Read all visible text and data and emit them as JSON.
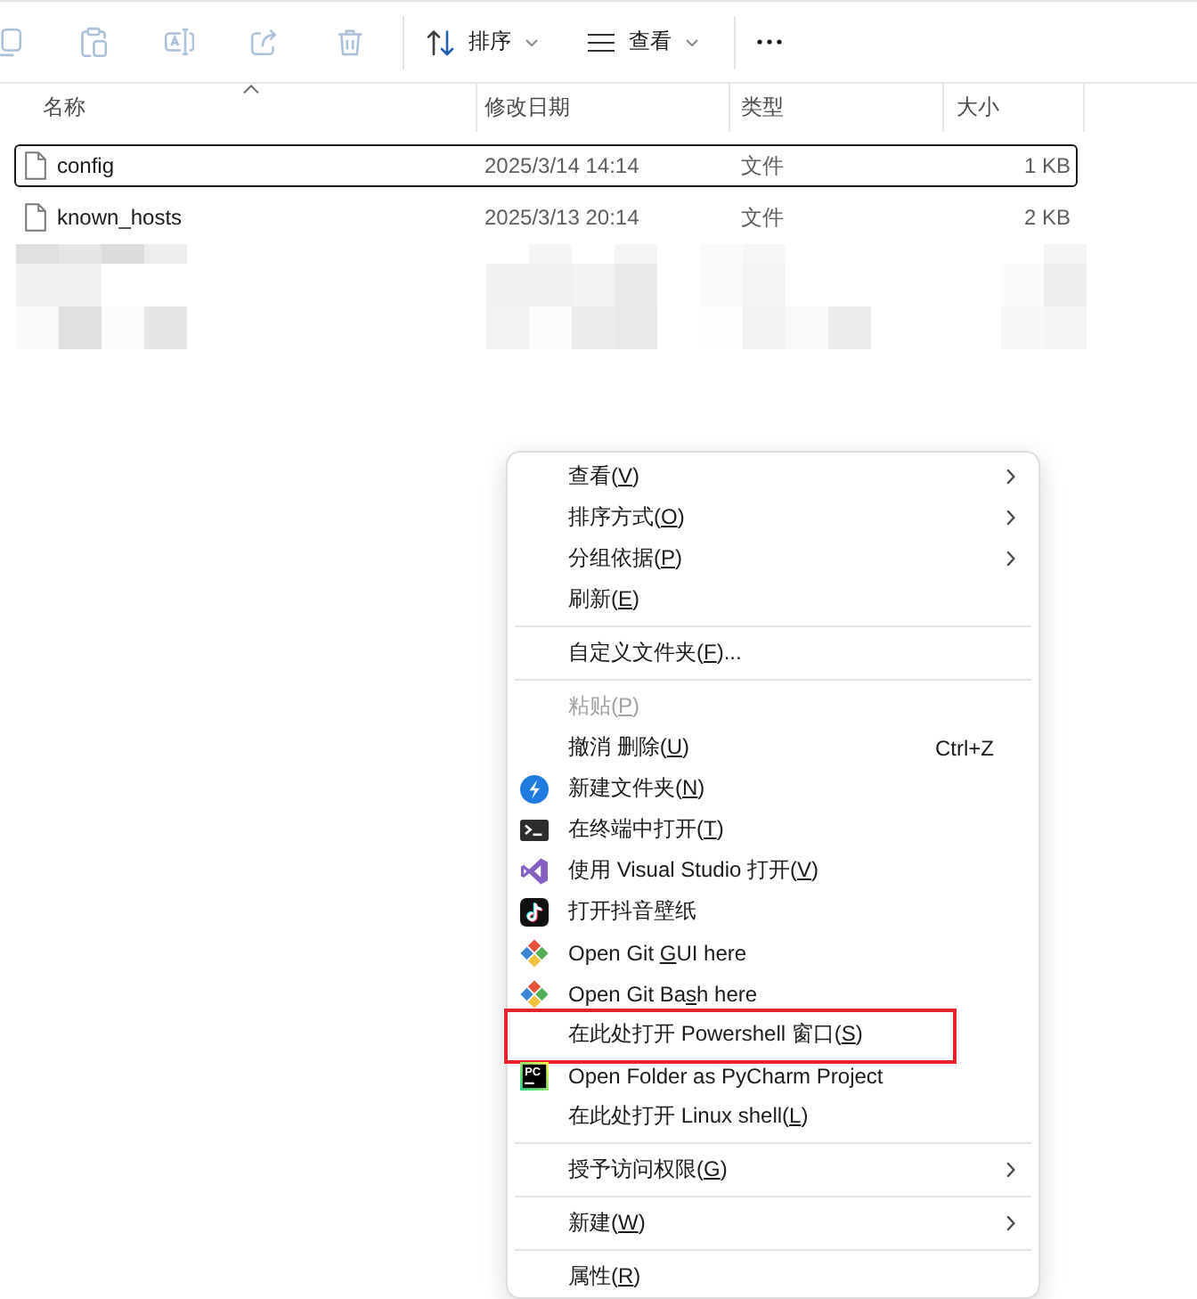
{
  "toolbar": {
    "items": [
      {
        "kind": "icon",
        "disabled": true
      },
      {
        "kind": "icon",
        "disabled": true
      },
      {
        "kind": "icon",
        "disabled": true
      },
      {
        "kind": "icon",
        "disabled": true
      },
      {
        "kind": "icon",
        "disabled": true
      },
      {
        "kind": "separator"
      },
      {
        "kind": "dropdown",
        "label": "排序",
        "disabled": false
      },
      {
        "kind": "dropdown",
        "label": "查看",
        "disabled": false
      },
      {
        "kind": "separator"
      },
      {
        "kind": "more",
        "disabled": false
      }
    ]
  },
  "file_list": {
    "columns": [
      {
        "label": "名称",
        "sorted": true
      },
      {
        "label": "修改日期",
        "sorted": false
      },
      {
        "label": "类型",
        "sorted": false
      },
      {
        "label": "大小",
        "sorted": false
      }
    ],
    "rows": [
      {
        "kind": "file",
        "name": "config",
        "modified": "2025/3/14 14:14",
        "type": "文件",
        "size": "1 KB",
        "selected": true
      },
      {
        "kind": "file",
        "name": "known_hosts",
        "modified": "2025/3/13 20:14",
        "type": "文件",
        "size": "2 KB",
        "selected": false
      },
      {
        "kind": "redacted"
      }
    ]
  },
  "context_menu": {
    "items": [
      {
        "kind": "item",
        "label": "查看(",
        "access_key": "V",
        "label_rest": ")",
        "submenu": true,
        "disabled": false,
        "highlighted": false
      },
      {
        "kind": "item",
        "label": "排序方式(",
        "access_key": "O",
        "label_rest": ")",
        "submenu": true,
        "disabled": false,
        "highlighted": false
      },
      {
        "kind": "item",
        "label": "分组依据(",
        "access_key": "P",
        "label_rest": ")",
        "submenu": true,
        "disabled": false,
        "highlighted": false
      },
      {
        "kind": "item",
        "label": "刷新(",
        "access_key": "E",
        "label_rest": ")",
        "submenu": false,
        "disabled": false,
        "highlighted": false
      },
      {
        "kind": "separator"
      },
      {
        "kind": "item",
        "label": "自定义文件夹(",
        "access_key": "F",
        "label_rest": ")...",
        "submenu": false,
        "disabled": false,
        "highlighted": false
      },
      {
        "kind": "separator"
      },
      {
        "kind": "item",
        "label": "粘贴(",
        "access_key": "P",
        "label_rest": ")",
        "submenu": false,
        "disabled": true,
        "highlighted": false
      },
      {
        "kind": "item",
        "label": "撤消 删除(",
        "access_key": "U",
        "label_rest": ")",
        "shortcut": "Ctrl+Z",
        "submenu": false,
        "disabled": false,
        "highlighted": false
      },
      {
        "kind": "item",
        "label": "新建文件夹(",
        "access_key": "N",
        "label_rest": ")",
        "submenu": false,
        "disabled": false,
        "highlighted": false
      },
      {
        "kind": "item",
        "label": "在终端中打开(",
        "access_key": "T",
        "label_rest": ")",
        "submenu": false,
        "disabled": false,
        "highlighted": false
      },
      {
        "kind": "item",
        "label": "使用 Visual Studio 打开(",
        "access_key": "V",
        "label_rest": ")",
        "submenu": false,
        "disabled": false,
        "highlighted": false
      },
      {
        "kind": "item",
        "label": "打开抖音壁纸",
        "submenu": false,
        "disabled": false,
        "highlighted": false
      },
      {
        "kind": "item",
        "label": "Open Git ",
        "access_key": "G",
        "label_rest": "UI here",
        "submenu": false,
        "disabled": false,
        "highlighted": false
      },
      {
        "kind": "item",
        "label": "Open Git Ba",
        "access_key": "s",
        "label_rest": "h here",
        "submenu": false,
        "disabled": false,
        "highlighted": false
      },
      {
        "kind": "item",
        "label": "在此处打开 Powershell 窗口(",
        "access_key": "S",
        "label_rest": ")",
        "submenu": false,
        "disabled": false,
        "highlighted": true
      },
      {
        "kind": "item",
        "label": "Open Folder as PyCharm Project",
        "icon_text": "PC",
        "submenu": false,
        "disabled": false,
        "highlighted": false
      },
      {
        "kind": "item",
        "label": "在此处打开 Linux shell(",
        "access_key": "L",
        "label_rest": ")",
        "submenu": false,
        "disabled": false,
        "highlighted": false
      },
      {
        "kind": "separator"
      },
      {
        "kind": "item",
        "label": "授予访问权限(",
        "access_key": "G",
        "label_rest": ")",
        "submenu": true,
        "disabled": false,
        "highlighted": false
      },
      {
        "kind": "separator"
      },
      {
        "kind": "item",
        "label": "新建(",
        "access_key": "W",
        "label_rest": ")",
        "submenu": true,
        "disabled": false,
        "highlighted": false
      },
      {
        "kind": "separator"
      },
      {
        "kind": "item",
        "label": "属性(",
        "access_key": "R",
        "label_rest": ")",
        "submenu": false,
        "disabled": false,
        "highlighted": false
      }
    ]
  }
}
